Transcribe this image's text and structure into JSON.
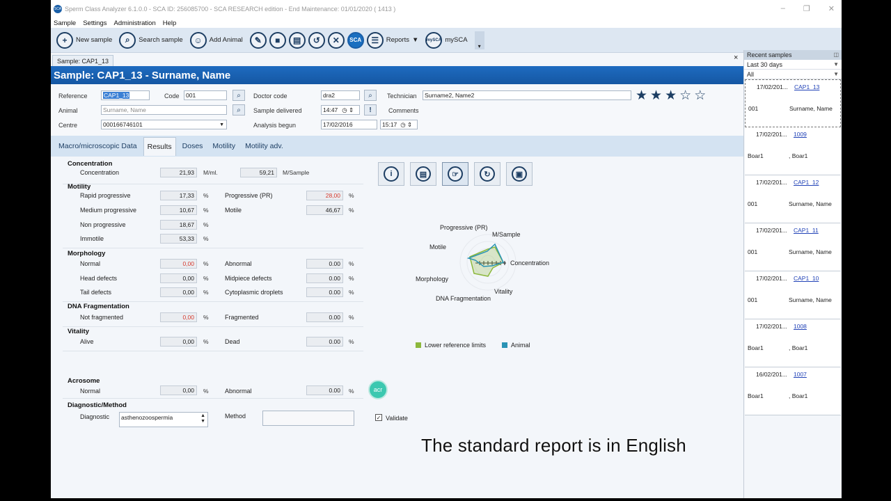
{
  "window": {
    "title": "Sperm Class Analyzer 6.1.0.0 - SCA ID: 256085700 - SCA RESEARCH edition - End Maintenance: 01/01/2020 ( 1413 )",
    "logo_text": "SCA",
    "controls": [
      "–",
      "❐",
      "✕"
    ]
  },
  "menu": [
    "Sample",
    "Settings",
    "Administration",
    "Help"
  ],
  "toolbar": {
    "new_sample": "New sample",
    "search_sample": "Search sample",
    "add_animal": "Add Animal",
    "sca_logo": "SCA",
    "reports": "Reports",
    "mysca_icon": "mySCA",
    "mysca": "mySCA",
    "more": "▾"
  },
  "doc_tab": {
    "label": "Sample: CAP1_13",
    "close": "×"
  },
  "header": {
    "title": "Sample: CAP1_13 - Surname, Name"
  },
  "info": {
    "reference_label": "Reference",
    "reference_value": "CAP1_13",
    "code_label": "Code",
    "code_value": "001",
    "doctor_label": "Doctor code",
    "doctor_value": "dra2",
    "technician_label": "Technician",
    "technician_value": "Surname2, Name2",
    "animal_label": "Animal",
    "animal_value": "Surname, Name",
    "delivered_label": "Sample delivered",
    "delivered_time": "14:47",
    "comments_label": "Comments",
    "centre_label": "Centre",
    "centre_value": "000166746101",
    "begun_label": "Analysis begun",
    "begun_date": "17/02/2016",
    "begun_time": "15:17",
    "rating": 3,
    "stars": [
      "★",
      "★",
      "★",
      "☆",
      "☆"
    ]
  },
  "tabs": [
    "Macro/microscopic Data",
    "Results",
    "Doses",
    "Motility",
    "Motility adv."
  ],
  "results": {
    "concentration": {
      "title": "Concentration",
      "label": "Concentration",
      "value": "21,93",
      "unit": "M/ml.",
      "value2": "59,21",
      "unit2": "M/Sample"
    },
    "motility": {
      "title": "Motility",
      "rapid_label": "Rapid progressive",
      "rapid": "17,33",
      "medium_label": "Medium progressive",
      "medium": "10,67",
      "non_label": "Non progressive",
      "non": "18,67",
      "immotile_label": "Immotile",
      "immotile": "53,33",
      "progressive_label": "Progressive (PR)",
      "progressive": "28,00",
      "motile_label": "Motile",
      "motile": "46,67"
    },
    "morphology": {
      "title": "Morphology",
      "normal_label": "Normal",
      "normal": "0,00",
      "head_label": "Head defects",
      "head": "0,00",
      "tail_label": "Tail defects",
      "tail": "0,00",
      "abnormal_label": "Abnormal",
      "abnormal": "0.00",
      "midpiece_label": "Midpiece defects",
      "midpiece": "0.00",
      "cyto_label": "Cytoplasmic droplets",
      "cyto": "0.00"
    },
    "dna": {
      "title": "DNA Fragmentation",
      "notfrag_label": "Not fragmented",
      "notfrag": "0,00",
      "frag_label": "Fragmented",
      "frag": "0.00"
    },
    "vitality": {
      "title": "Vitality",
      "alive_label": "Alive",
      "alive": "0,00",
      "dead_label": "Dead",
      "dead": "0.00"
    },
    "acrosome": {
      "title": "Acrosome",
      "normal_label": "Normal",
      "normal": "0,00",
      "abnormal_label": "Abnormal",
      "abnormal": "0.00",
      "button": "acr"
    },
    "diagnostic": {
      "title": "Diagnostic/Method",
      "diag_label": "Diagnostic",
      "diag_value": "asthenozoospermia",
      "method_label": "Method",
      "method_value": "",
      "validate_label": "Validate",
      "validate_checked": true
    },
    "unit_pct": "%"
  },
  "radar": {
    "labels": [
      "Progressive (PR)",
      "M/Sample",
      "Concentration",
      "Vitality",
      "DNA Fragmentation",
      "Morphology",
      "Motile"
    ],
    "legend": [
      {
        "name": "Lower reference limits",
        "color": "#8cb83c"
      },
      {
        "name": "Animal",
        "color": "#2a93b5"
      }
    ]
  },
  "recent": {
    "header": "Recent samples",
    "period": "Last 30 days",
    "filter": "All",
    "items": [
      {
        "date": "17/02/201...",
        "id": "CAP1_13",
        "code": "001",
        "name": "Surname, Name"
      },
      {
        "date": "17/02/201...",
        "id": "1009",
        "code": "Boar1",
        "name": ", Boar1"
      },
      {
        "date": "17/02/201...",
        "id": "CAP1_12",
        "code": "001",
        "name": "Surname, Name"
      },
      {
        "date": "17/02/201...",
        "id": "CAP1_11",
        "code": "001",
        "name": "Surname, Name"
      },
      {
        "date": "17/02/201...",
        "id": "CAP1_10",
        "code": "001",
        "name": "Surname, Name"
      },
      {
        "date": "17/02/201...",
        "id": "1008",
        "code": "Boar1",
        "name": ", Boar1"
      },
      {
        "date": "16/02/201...",
        "id": "1007",
        "code": "Boar1",
        "name": ", Boar1"
      }
    ]
  },
  "caption": "The standard report is in English"
}
